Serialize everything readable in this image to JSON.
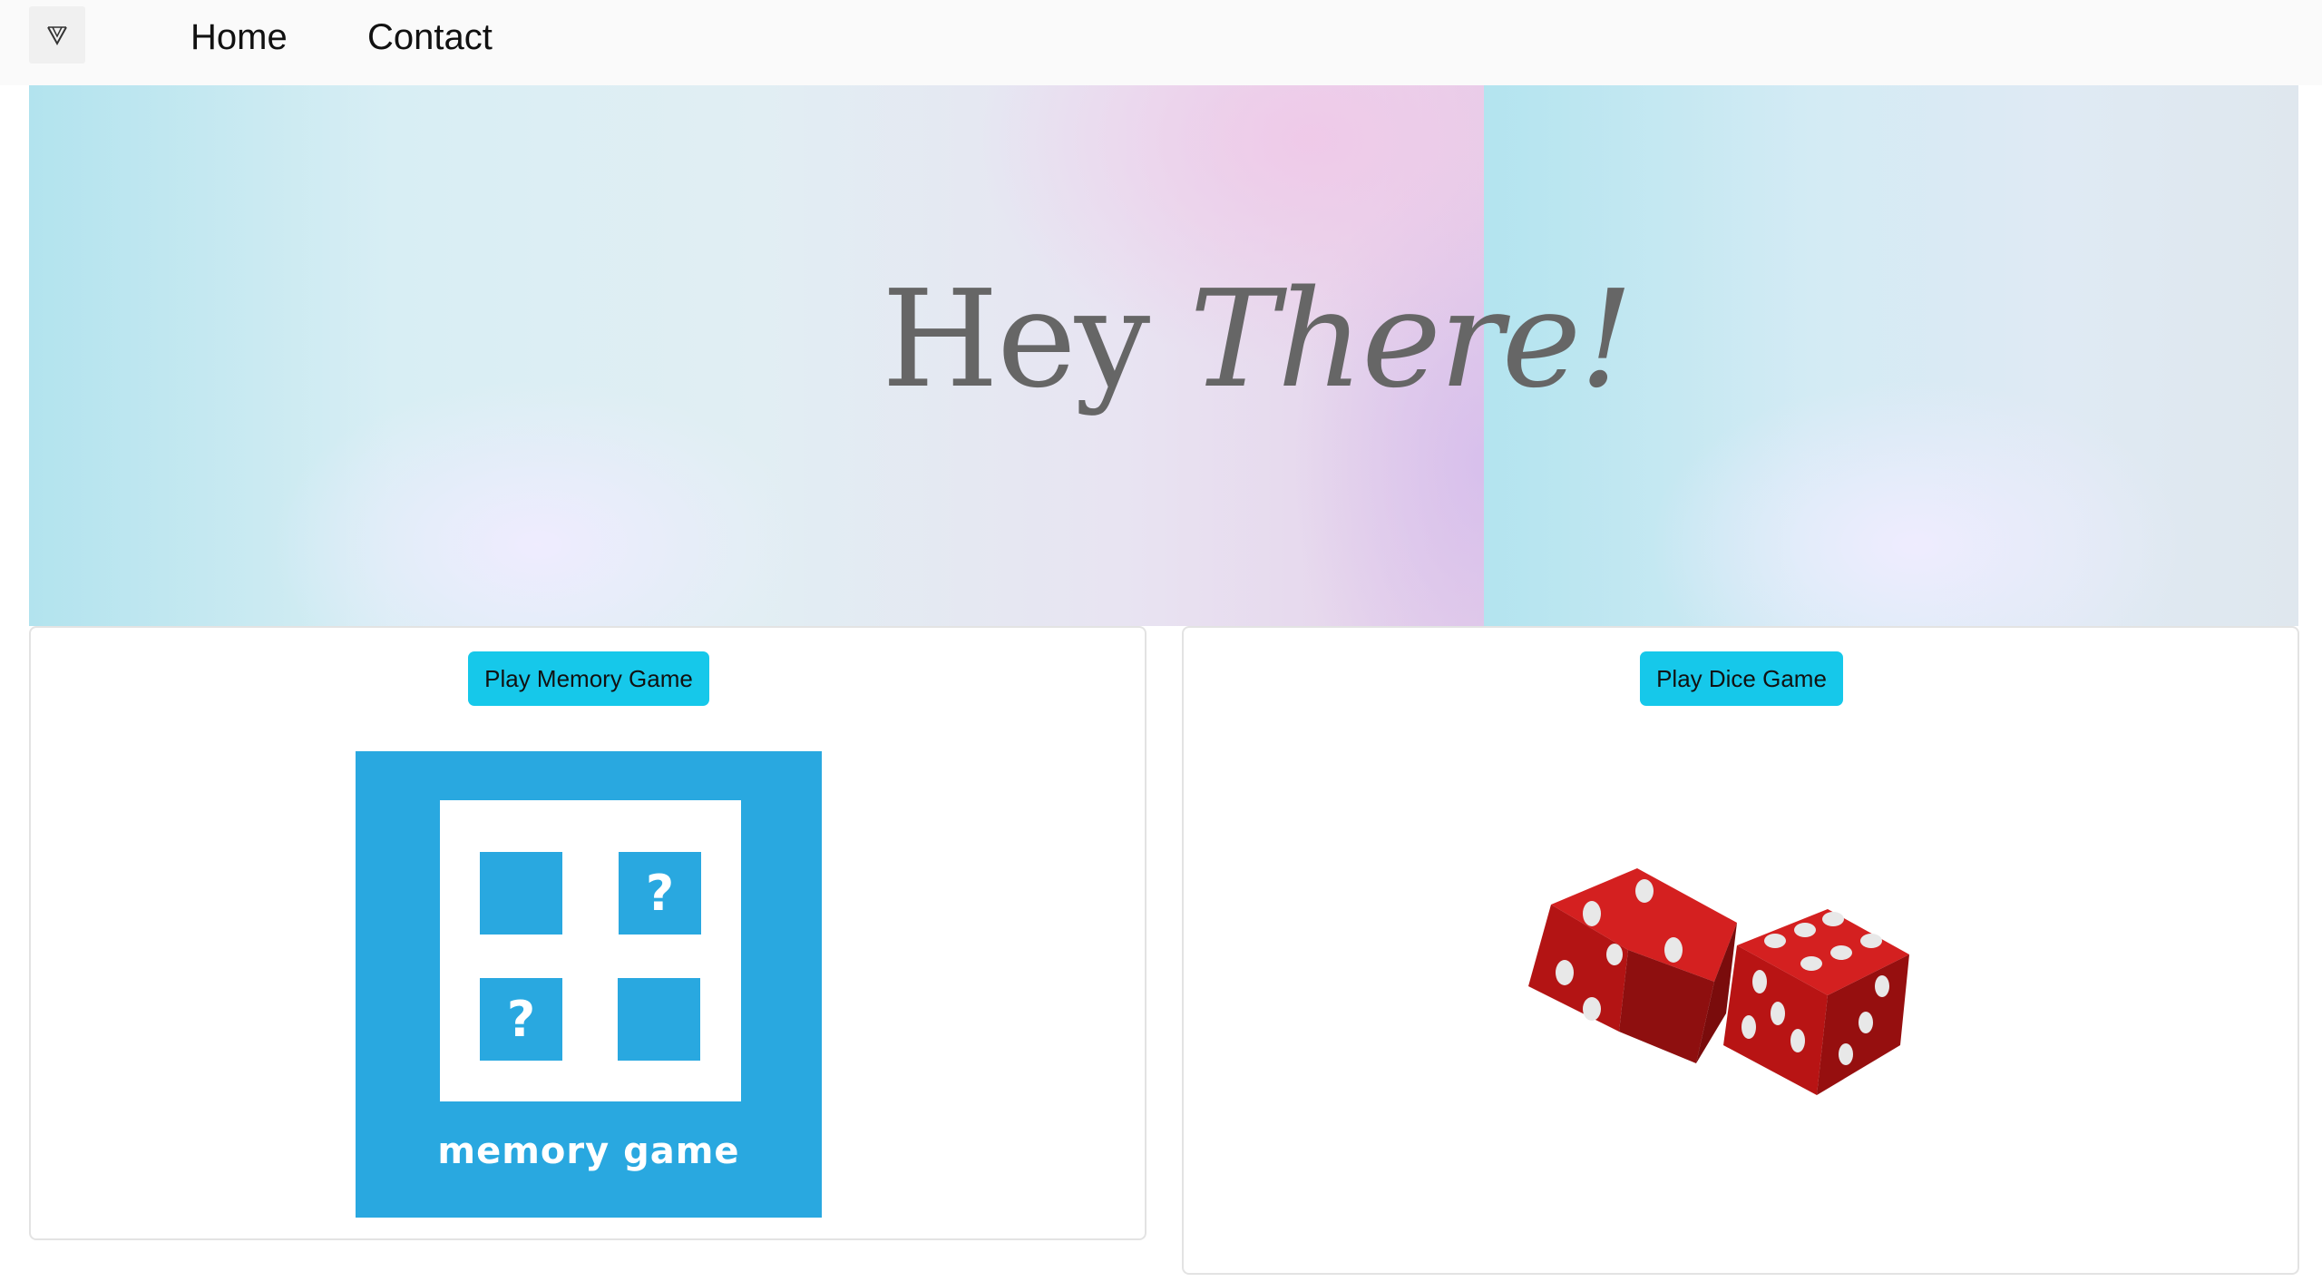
{
  "navbar": {
    "brand_icon": "v-logo-icon",
    "links": [
      {
        "label": "Home"
      },
      {
        "label": "Contact"
      }
    ]
  },
  "hero": {
    "title_plain": "Hey",
    "title_italic": "There!"
  },
  "cards": [
    {
      "button_label": "Play Memory Game",
      "image": {
        "tiles": [
          "",
          "?",
          "?",
          ""
        ],
        "caption": "memory game"
      }
    },
    {
      "button_label": "Play Dice Game",
      "image": {
        "icon": "red-dice-icon"
      }
    }
  ],
  "colors": {
    "accent_button": "#16c8ea",
    "memory_blue": "#29a8e0",
    "dice_red": "#c81a1a",
    "hero_text": "#666666"
  }
}
